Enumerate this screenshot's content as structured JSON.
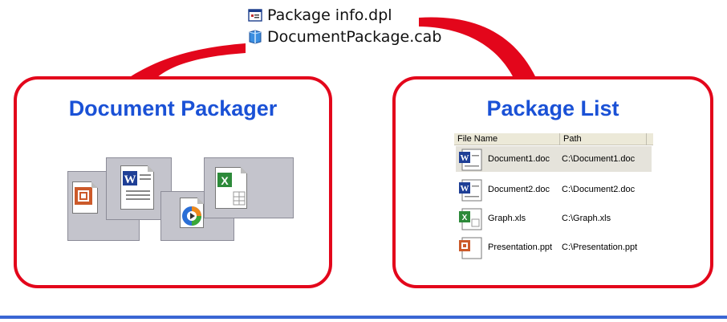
{
  "files": [
    {
      "name": "Package info.dpl",
      "icon": "dpl-file-icon"
    },
    {
      "name": "DocumentPackage.cab",
      "icon": "cab-file-icon"
    }
  ],
  "left_panel": {
    "title": "Document Packager",
    "icons": [
      "powerpoint-icon",
      "word-icon",
      "media-player-icon",
      "excel-icon"
    ]
  },
  "right_panel": {
    "title": "Package List",
    "columns": [
      "File Name",
      "Path"
    ],
    "rows": [
      {
        "name": "Document1.doc",
        "path": "C:\\Document1.doc",
        "icon": "word-icon",
        "selected": true
      },
      {
        "name": "Document2.doc",
        "path": "C:\\Document2.doc",
        "icon": "word-icon",
        "selected": false
      },
      {
        "name": "Graph.xls",
        "path": "C:\\Graph.xls",
        "icon": "excel-icon",
        "selected": false
      },
      {
        "name": "Presentation.ppt",
        "path": "C:\\Presentation.ppt",
        "icon": "powerpoint-icon",
        "selected": false
      }
    ]
  },
  "colors": {
    "frame": "#e3061b",
    "title": "#1a51d6",
    "rule": "#3a66d4"
  }
}
